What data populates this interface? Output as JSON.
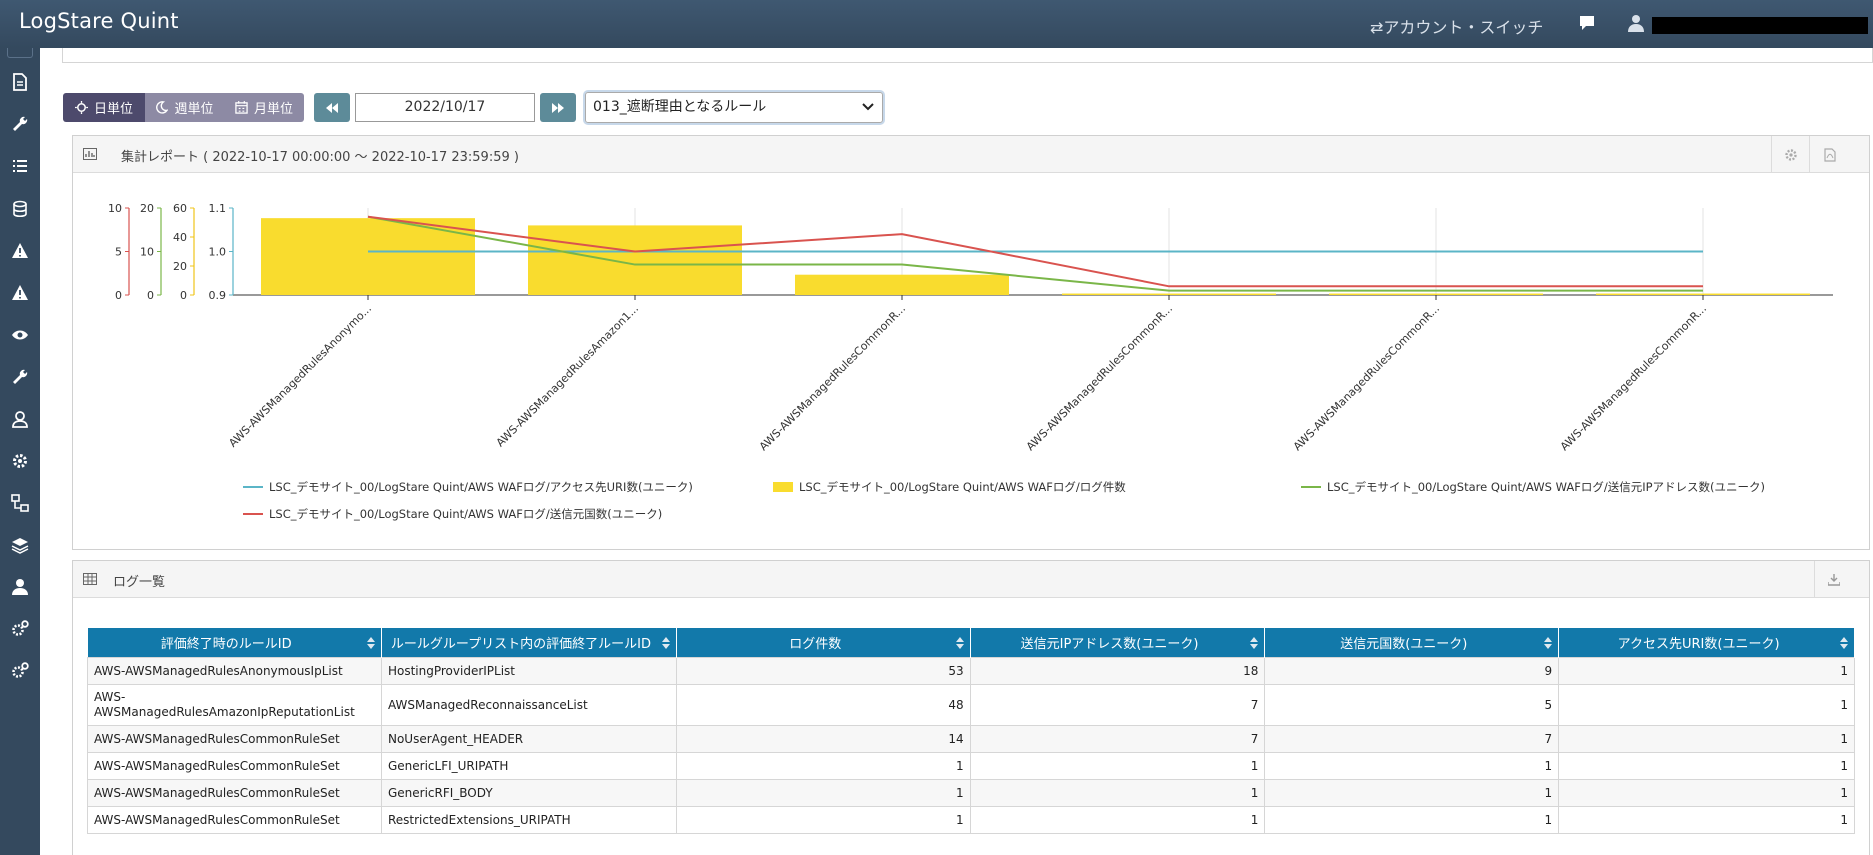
{
  "app": {
    "title": "LogStare Quint",
    "account_switch": "⇄アカウント・スイッチ"
  },
  "sidebar": {
    "items": [
      {
        "icon": "file-icon"
      },
      {
        "icon": "wrench-icon"
      },
      {
        "icon": "list-icon"
      },
      {
        "icon": "database-icon"
      },
      {
        "icon": "warning-icon"
      },
      {
        "icon": "warning-icon"
      },
      {
        "icon": "eye-icon"
      },
      {
        "icon": "wrench-icon"
      },
      {
        "icon": "user-shield-icon"
      },
      {
        "icon": "gear-icon"
      },
      {
        "icon": "sitemap-icon"
      },
      {
        "icon": "layers-icon"
      },
      {
        "icon": "user-tie-icon"
      },
      {
        "icon": "cogs-icon"
      },
      {
        "icon": "cogs-icon"
      }
    ]
  },
  "toolbar": {
    "day_label": "日単位",
    "week_label": "週単位",
    "month_label": "月単位",
    "date_value": "2022/10/17",
    "rule_select_value": "013_遮断理由となるルール"
  },
  "report": {
    "title": "集計レポート ( 2022-10-17 00:00:00 ～ 2022-10-17 23:59:59 )"
  },
  "chart_data": {
    "type": "bar",
    "categories": [
      "AWS-AWSManagedRulesAnonymo...",
      "AWS-AWSManagedRulesAmazon1...",
      "AWS-AWSManagedRulesCommonR...",
      "AWS-AWSManagedRulesCommonR...",
      "AWS-AWSManagedRulesCommonR...",
      "AWS-AWSManagedRulesCommonR..."
    ],
    "axes": [
      {
        "color": "#d9534f",
        "ticks": [
          "10",
          "5",
          "0"
        ],
        "ylim": [
          0,
          10
        ]
      },
      {
        "color": "#7ab648",
        "ticks": [
          "20",
          "10",
          "0"
        ],
        "ylim": [
          0,
          20
        ]
      },
      {
        "color": "#f0c419",
        "ticks": [
          "60",
          "40",
          "20",
          "0"
        ],
        "ylim": [
          0,
          60
        ]
      },
      {
        "color": "#5bb5c7",
        "ticks": [
          "1.1",
          "1.0",
          "0.9"
        ],
        "ylim": [
          0.9,
          1.1
        ]
      }
    ],
    "series": [
      {
        "name": "LSC_デモサイト_00/LogStare Quint/AWS WAFログ/アクセス先URI数(ユニーク)",
        "type": "line",
        "color": "#5bb5c7",
        "axis": 3,
        "values": [
          1,
          1,
          1,
          1,
          1,
          1
        ]
      },
      {
        "name": "LSC_デモサイト_00/LogStare Quint/AWS WAFログ/ログ件数",
        "type": "bar",
        "color": "#f9dc2e",
        "axis": 2,
        "values": [
          53,
          48,
          14,
          1,
          1,
          1
        ]
      },
      {
        "name": "LSC_デモサイト_00/LogStare Quint/AWS WAFログ/送信元IPアドレス数(ユニーク)",
        "type": "line",
        "color": "#7ab648",
        "axis": 1,
        "values": [
          18,
          7,
          7,
          1,
          1,
          1
        ]
      },
      {
        "name": "LSC_デモサイト_00/LogStare Quint/AWS WAFログ/送信元国数(ユニーク)",
        "type": "line",
        "color": "#d9534f",
        "axis": 0,
        "values": [
          9,
          5,
          7,
          1,
          1,
          1
        ]
      }
    ],
    "legend_position": "bottom"
  },
  "log": {
    "title": "ログ一覧",
    "columns": [
      "評価終了時のルールID",
      "ルールグループリスト内の評価終了ルールID",
      "ログ件数",
      "送信元IPアドレス数(ユニーク)",
      "送信元国数(ユニーク)",
      "アクセス先URI数(ユニーク)"
    ],
    "rows": [
      [
        "AWS-AWSManagedRulesAnonymousIpList",
        "HostingProviderIPList",
        "53",
        "18",
        "9",
        "1"
      ],
      [
        "AWS-AWSManagedRulesAmazonIpReputationList",
        "AWSManagedReconnaissanceList",
        "48",
        "7",
        "5",
        "1"
      ],
      [
        "AWS-AWSManagedRulesCommonRuleSet",
        "NoUserAgent_HEADER",
        "14",
        "7",
        "7",
        "1"
      ],
      [
        "AWS-AWSManagedRulesCommonRuleSet",
        "GenericLFI_URIPATH",
        "1",
        "1",
        "1",
        "1"
      ],
      [
        "AWS-AWSManagedRulesCommonRuleSet",
        "GenericRFI_BODY",
        "1",
        "1",
        "1",
        "1"
      ],
      [
        "AWS-AWSManagedRulesCommonRuleSet",
        "RestrictedExtensions_URIPATH",
        "1",
        "1",
        "1",
        "1"
      ]
    ]
  }
}
